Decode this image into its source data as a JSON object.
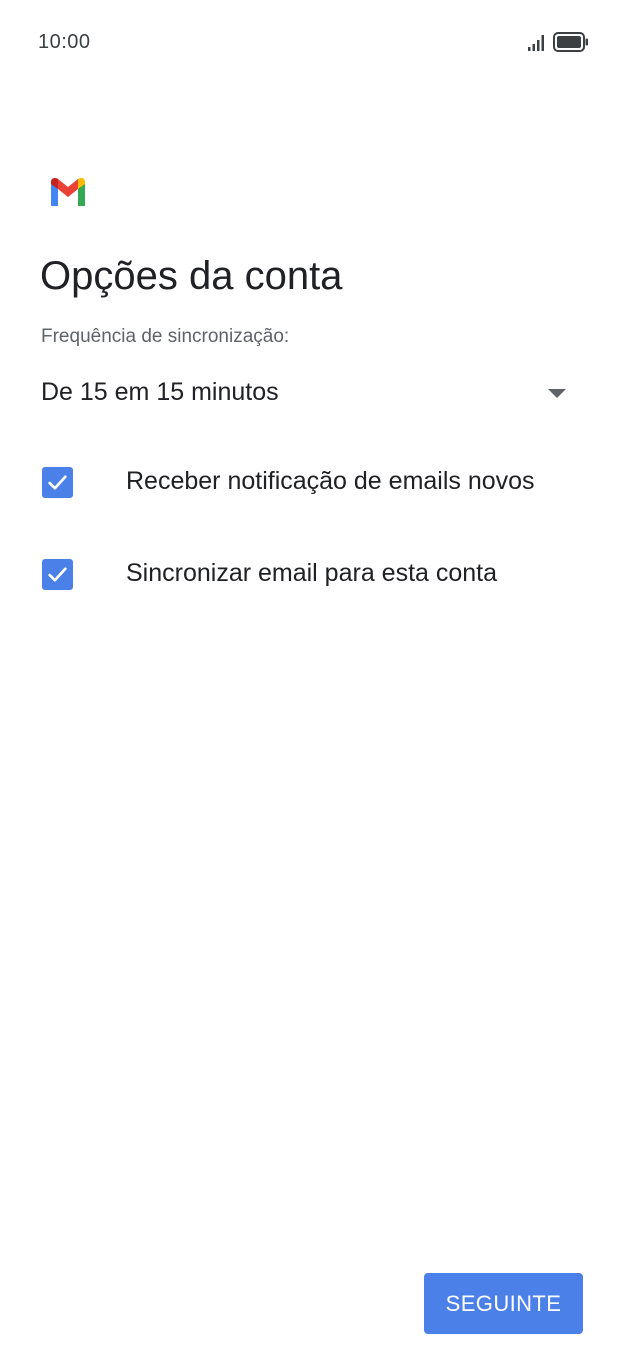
{
  "status_bar": {
    "time": "10:00",
    "signal_icon": "cellular-signal-icon",
    "battery_icon": "battery-full-icon"
  },
  "header": {
    "logo_icon": "gmail-logo-icon",
    "title": "Opções da conta"
  },
  "sync": {
    "label": "Frequência de sincronização:",
    "selected_value": "De 15 em 15 minutos",
    "dropdown_icon": "caret-down-icon"
  },
  "options": [
    {
      "label": "Receber notificação de emails novos",
      "checked": true
    },
    {
      "label": "Sincronizar email para esta conta",
      "checked": true
    }
  ],
  "footer": {
    "next_button_label": "SEGUINTE"
  },
  "colors": {
    "accent": "#4a80e8",
    "text_primary": "#202124",
    "text_secondary": "#5f6368"
  }
}
